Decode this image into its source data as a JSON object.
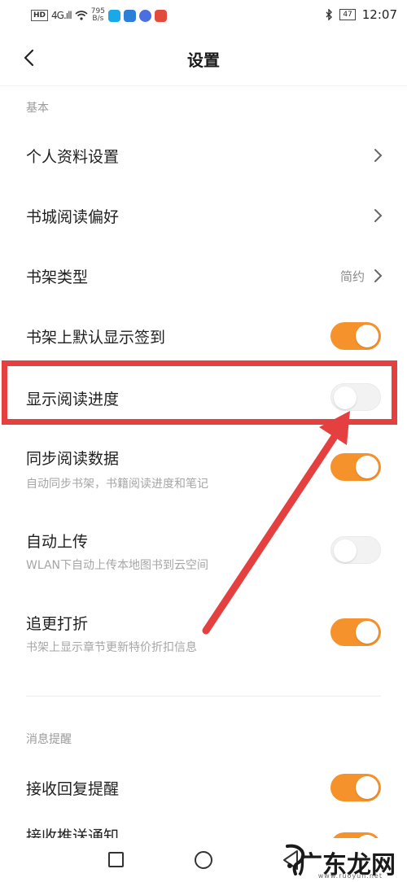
{
  "status_bar": {
    "network": "HD",
    "signal": "4G.ıll",
    "speed_value": "795",
    "speed_unit": "B/s",
    "battery": "47",
    "time": "12:07"
  },
  "header": {
    "title": "设置"
  },
  "sections": {
    "basic_label": "基本",
    "notify_label": "消息提醒"
  },
  "rows": {
    "profile": {
      "title": "个人资料设置"
    },
    "store_pref": {
      "title": "书城阅读偏好"
    },
    "shelf_type": {
      "title": "书架类型",
      "value": "简约"
    },
    "shelf_signin": {
      "title": "书架上默认显示签到",
      "on": true
    },
    "show_progress": {
      "title": "显示阅读进度",
      "on": false
    },
    "sync": {
      "title": "同步阅读数据",
      "subtitle": "自动同步书架，书籍阅读进度和笔记",
      "on": true
    },
    "auto_upload": {
      "title": "自动上传",
      "subtitle": "WLAN下自动上传本地图书到云空间",
      "on": false
    },
    "discount": {
      "title": "追更打折",
      "subtitle": "书架上显示章节更新特价折扣信息",
      "on": true
    },
    "reply_notice": {
      "title": "接收回复提醒",
      "on": true
    },
    "push_notice": {
      "title": "接收推送通知",
      "on": true
    }
  },
  "watermark": {
    "text": "广东龙网",
    "sub": "www.ruoyun.net"
  },
  "colors": {
    "accent": "#f5922b",
    "highlight": "#e54040"
  }
}
